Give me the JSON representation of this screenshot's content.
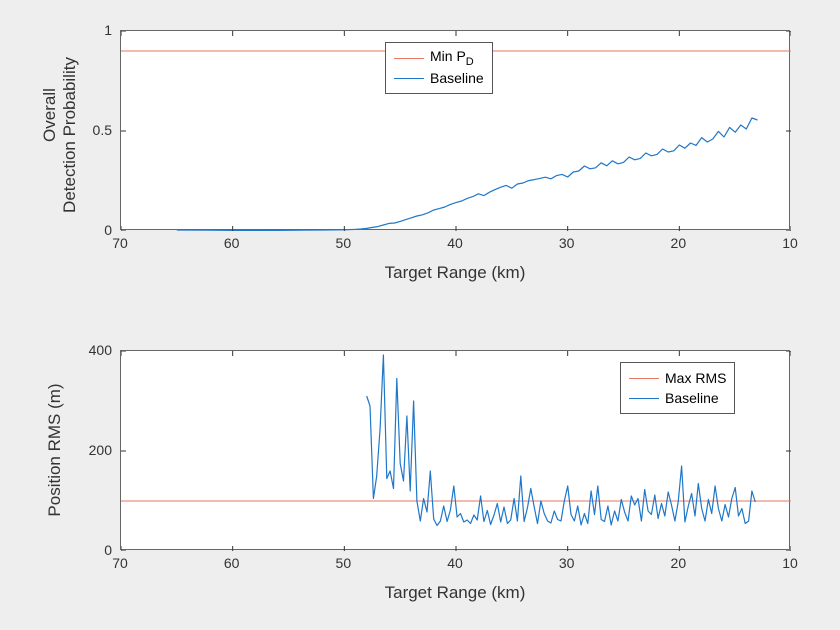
{
  "chart_data": [
    {
      "type": "line",
      "title": "",
      "xlabel": "Target Range (km)",
      "ylabel": "Overall\nDetection Probability",
      "xlim": [
        70,
        10
      ],
      "ylim": [
        0,
        1
      ],
      "xticks": [
        70,
        60,
        50,
        40,
        30,
        20,
        10
      ],
      "yticks": [
        0,
        0.5,
        1
      ],
      "legend_pos": "upper-center",
      "series": [
        {
          "name": "Min P_D",
          "color": "#e57762",
          "mode": "hline",
          "y": 0.9
        },
        {
          "name": "Baseline",
          "color": "#1f77c9",
          "mode": "xy",
          "x": [
            65,
            62,
            60,
            58,
            56,
            54,
            52,
            50,
            49,
            48.5,
            48,
            47.5,
            47,
            46.5,
            46,
            45.5,
            45,
            44.5,
            44,
            43.5,
            43,
            42.5,
            42,
            41.5,
            41,
            40.5,
            40,
            39.5,
            39,
            38.5,
            38,
            37.5,
            37,
            36.5,
            36,
            35.5,
            35,
            34.5,
            34,
            33.5,
            33,
            32.5,
            32,
            31.5,
            31,
            30.5,
            30,
            29.5,
            29,
            28.5,
            28,
            27.5,
            27,
            26.5,
            26,
            25.5,
            25,
            24.5,
            24,
            23.5,
            23,
            22.5,
            22,
            21.5,
            21,
            20.5,
            20,
            19.5,
            19,
            18.5,
            18,
            17.5,
            17,
            16.5,
            16,
            15.5,
            15,
            14.5,
            14,
            13.5,
            13
          ],
          "y": [
            0.0,
            0.001,
            0.002,
            0.002,
            0.003,
            0.004,
            0.005,
            0.006,
            0.008,
            0.01,
            0.013,
            0.018,
            0.022,
            0.03,
            0.038,
            0.04,
            0.048,
            0.057,
            0.066,
            0.075,
            0.081,
            0.091,
            0.105,
            0.112,
            0.12,
            0.133,
            0.142,
            0.15,
            0.163,
            0.172,
            0.186,
            0.177,
            0.194,
            0.207,
            0.219,
            0.228,
            0.214,
            0.235,
            0.24,
            0.252,
            0.257,
            0.263,
            0.269,
            0.261,
            0.277,
            0.283,
            0.27,
            0.295,
            0.3,
            0.325,
            0.311,
            0.316,
            0.341,
            0.326,
            0.351,
            0.336,
            0.343,
            0.37,
            0.356,
            0.363,
            0.39,
            0.376,
            0.383,
            0.41,
            0.395,
            0.401,
            0.43,
            0.414,
            0.44,
            0.428,
            0.467,
            0.445,
            0.46,
            0.498,
            0.47,
            0.518,
            0.494,
            0.53,
            0.51,
            0.565,
            0.555
          ]
        }
      ]
    },
    {
      "type": "line",
      "title": "",
      "xlabel": "Target Range (km)",
      "ylabel": "Position RMS (m)",
      "xlim": [
        70,
        10
      ],
      "ylim": [
        0,
        400
      ],
      "xticks": [
        70,
        60,
        50,
        40,
        30,
        20,
        10
      ],
      "yticks": [
        0,
        200,
        400
      ],
      "legend_pos": "upper-right",
      "series": [
        {
          "name": "Max RMS",
          "color": "#e57762",
          "mode": "hline",
          "y": 100
        },
        {
          "name": "Baseline",
          "color": "#1f77c9",
          "mode": "xy",
          "x": [
            48,
            47.7,
            47.4,
            47.1,
            46.8,
            46.5,
            46.2,
            45.9,
            45.6,
            45.3,
            45,
            44.7,
            44.4,
            44.1,
            43.8,
            43.5,
            43.2,
            42.9,
            42.6,
            42.3,
            42,
            41.7,
            41.4,
            41.1,
            40.8,
            40.5,
            40.2,
            39.9,
            39.6,
            39.3,
            39,
            38.7,
            38.4,
            38.1,
            37.8,
            37.5,
            37.2,
            36.9,
            36.6,
            36.3,
            36,
            35.7,
            35.4,
            35.1,
            34.8,
            34.5,
            34.2,
            33.9,
            33.6,
            33.3,
            33,
            32.7,
            32.4,
            32.1,
            31.8,
            31.5,
            31.2,
            30.9,
            30.6,
            30.3,
            30,
            29.7,
            29.4,
            29.1,
            28.8,
            28.5,
            28.2,
            27.9,
            27.6,
            27.3,
            27,
            26.7,
            26.4,
            26.1,
            25.8,
            25.5,
            25.2,
            24.9,
            24.6,
            24.3,
            24,
            23.7,
            23.4,
            23.1,
            22.8,
            22.5,
            22.2,
            21.9,
            21.6,
            21.3,
            21,
            20.7,
            20.4,
            20.1,
            19.8,
            19.5,
            19.2,
            18.9,
            18.6,
            18.3,
            18,
            17.7,
            17.4,
            17.1,
            16.8,
            16.5,
            16.2,
            15.9,
            15.6,
            15.3,
            15,
            14.7,
            14.4,
            14.1,
            13.8,
            13.5,
            13.2
          ],
          "y": [
            310,
            290,
            105,
            150,
            245,
            392,
            145,
            160,
            125,
            345,
            175,
            140,
            270,
            120,
            300,
            100,
            60,
            105,
            78,
            160,
            64,
            51,
            60,
            90,
            59,
            82,
            130,
            68,
            75,
            58,
            62,
            55,
            72,
            62,
            110,
            59,
            81,
            53,
            72,
            95,
            58,
            88,
            55,
            62,
            105,
            60,
            150,
            59,
            87,
            125,
            88,
            55,
            100,
            75,
            60,
            56,
            80,
            63,
            60,
            100,
            130,
            73,
            60,
            90,
            52,
            75,
            55,
            120,
            73,
            130,
            63,
            59,
            90,
            52,
            80,
            60,
            103,
            78,
            60,
            110,
            92,
            105,
            60,
            123,
            80,
            73,
            112,
            65,
            95,
            70,
            118,
            92,
            60,
            98,
            170,
            58,
            90,
            115,
            70,
            135,
            85,
            60,
            103,
            75,
            130,
            85,
            60,
            93,
            68,
            105,
            127,
            70,
            85,
            55,
            60,
            120,
            98
          ]
        }
      ]
    }
  ]
}
